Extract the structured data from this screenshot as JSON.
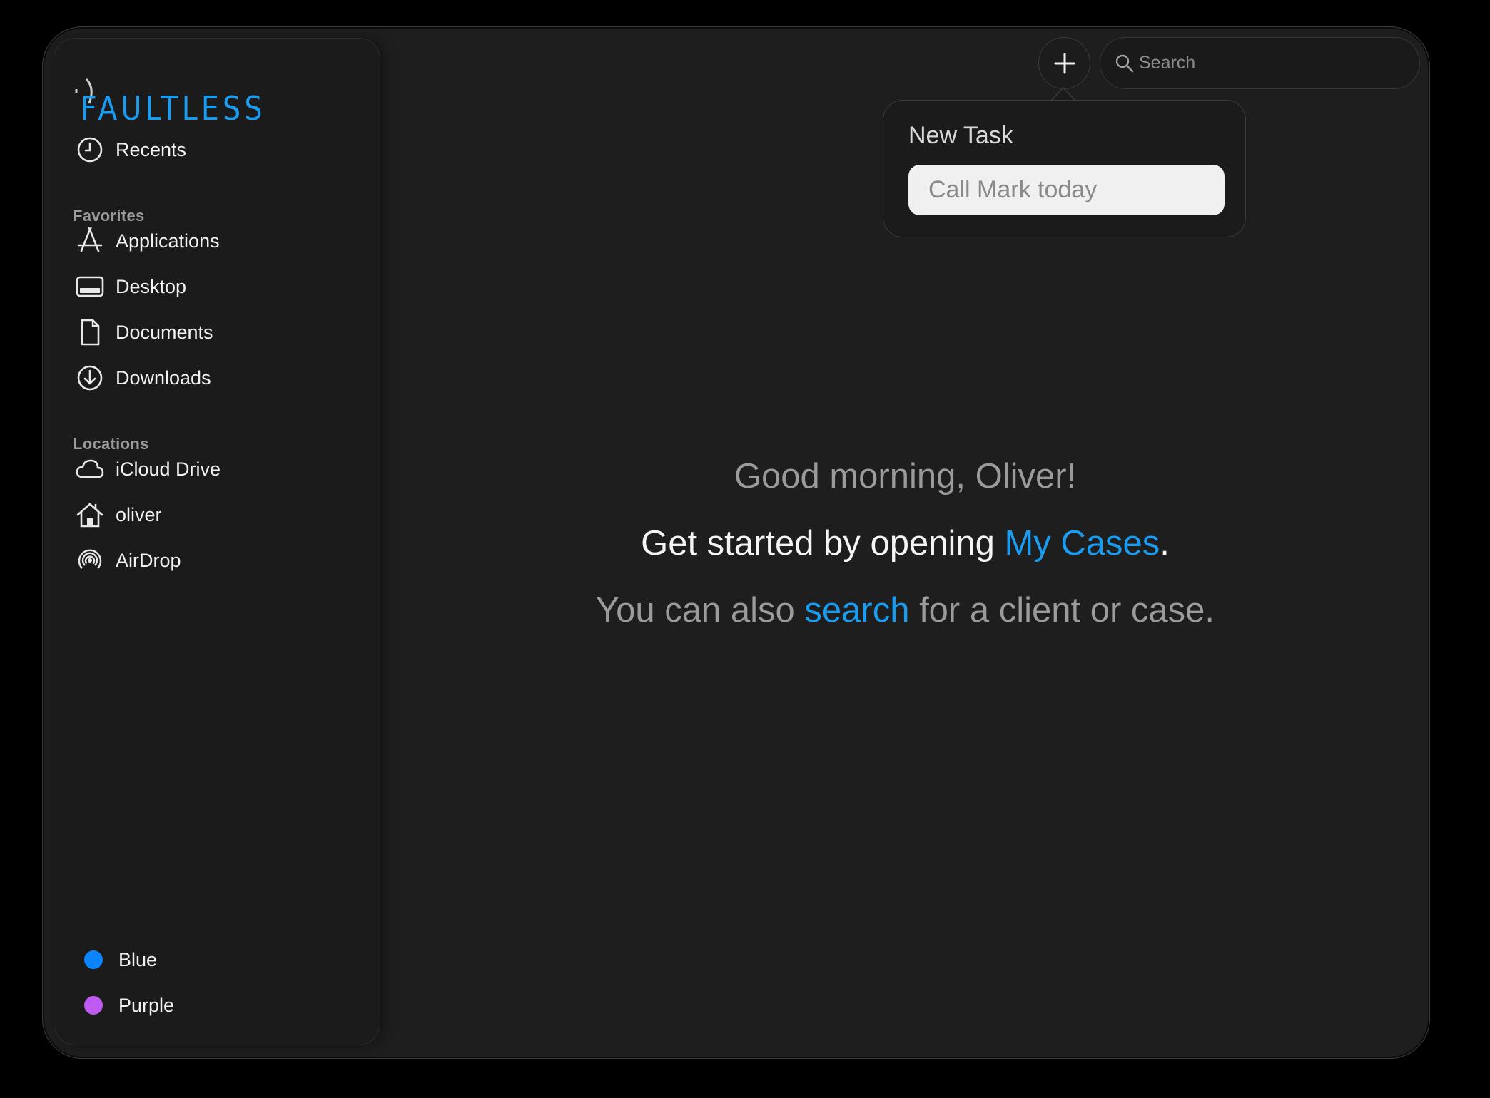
{
  "sidebar": {
    "logo_text": "FAULTLESS",
    "recents_label": "Recents",
    "favorites_header": "Favorites",
    "favorites": [
      {
        "label": "Applications",
        "icon": "applications-icon"
      },
      {
        "label": "Desktop",
        "icon": "desktop-icon"
      },
      {
        "label": "Documents",
        "icon": "document-icon"
      },
      {
        "label": "Downloads",
        "icon": "download-icon"
      }
    ],
    "locations_header": "Locations",
    "locations": [
      {
        "label": "iCloud Drive",
        "icon": "cloud-icon"
      },
      {
        "label": "oliver",
        "icon": "home-icon"
      },
      {
        "label": "AirDrop",
        "icon": "airdrop-icon"
      }
    ],
    "tags": [
      {
        "label": "Blue",
        "color": "#0a84ff"
      },
      {
        "label": "Purple",
        "color": "#bf5af2"
      }
    ]
  },
  "toolbar": {
    "add_icon": "plus-icon",
    "search_placeholder": "Search"
  },
  "popover": {
    "title": "New Task",
    "input_placeholder": "Call Mark today"
  },
  "main": {
    "greeting": "Good morning, Oliver!",
    "line2_prefix": "Get started by opening ",
    "line2_link": "My Cases",
    "line2_suffix": ".",
    "line3_prefix": "You can also ",
    "line3_link": "search",
    "line3_suffix": " for a client or case."
  },
  "colors": {
    "accent": "#1a9cf0",
    "background": "#1e1e1e",
    "sidebar": "#1b1b1b"
  }
}
